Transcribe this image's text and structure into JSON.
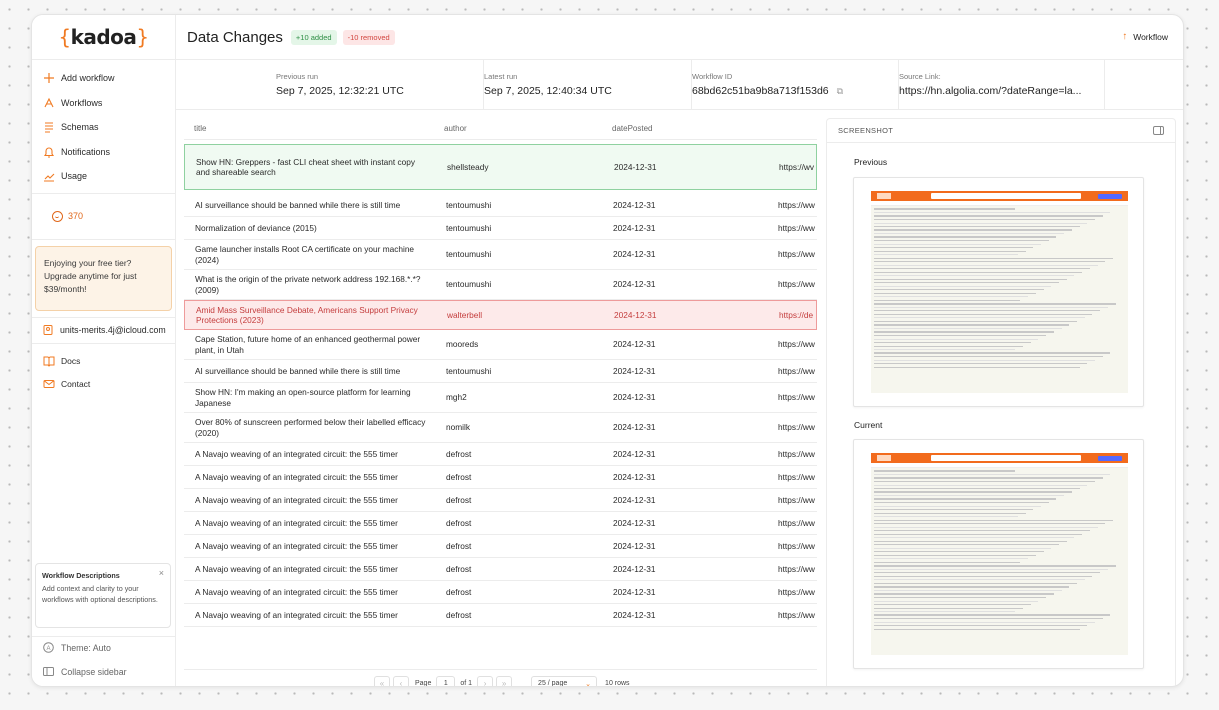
{
  "brand": {
    "logo_open": "{",
    "logo_text": "kadoa",
    "logo_close": "}"
  },
  "sidebar": {
    "nav": [
      {
        "label": "Add workflow",
        "icon": "plus-icon"
      },
      {
        "label": "Workflows",
        "icon": "workflow-icon"
      },
      {
        "label": "Schemas",
        "icon": "schema-icon"
      },
      {
        "label": "Notifications",
        "icon": "bell-icon"
      },
      {
        "label": "Usage",
        "icon": "chart-icon"
      }
    ],
    "credits": "370",
    "upsell": "Enjoying your free tier? Upgrade anytime for just $39/month!",
    "user_email": "units-merits.4j@icloud.com",
    "links": [
      {
        "label": "Docs",
        "icon": "book-icon"
      },
      {
        "label": "Contact",
        "icon": "mail-icon"
      }
    ],
    "workflow_desc": {
      "title": "Workflow Descriptions",
      "close": "×",
      "body": "Add context and clarity to your workflows with optional descriptions."
    },
    "theme": "Theme: Auto",
    "collapse": "Collapse sidebar"
  },
  "header": {
    "title": "Data Changes",
    "added_badge": "+10 added",
    "removed_badge": "-10 removed",
    "workflow_button": "Workflow"
  },
  "run_info": {
    "previous_label": "Previous run",
    "previous_value": "Sep 7, 2025, 12:32:21 UTC",
    "latest_label": "Latest run",
    "latest_value": "Sep 7, 2025, 12:40:34 UTC",
    "workflow_id_label": "Workflow ID",
    "workflow_id_value": "68bd62c51ba9b8a713f153d6",
    "source_label": "Source Link:",
    "source_value": "https://hn.algolia.com/?dateRange=la..."
  },
  "table": {
    "columns": [
      "title",
      "author",
      "datePosted"
    ],
    "rows": [
      {
        "title": "Show HN: Greppers - fast CLI cheat sheet with instant copy and shareable search",
        "author": "shellsteady",
        "date": "2024-12-31",
        "url": "https://wv",
        "status": "added"
      },
      {
        "title": "AI surveillance should be banned while there is still time",
        "author": "tentoumushi",
        "date": "2024-12-31",
        "url": "https://ww",
        "status": ""
      },
      {
        "title": "Normalization of deviance (2015)",
        "author": "tentoumushi",
        "date": "2024-12-31",
        "url": "https://ww",
        "status": ""
      },
      {
        "title": "Game launcher installs Root CA certificate on your machine (2024)",
        "author": "tentoumushi",
        "date": "2024-12-31",
        "url": "https://ww",
        "status": ""
      },
      {
        "title": "What is the origin of the private network address 192.168.*.*? (2009)",
        "author": "tentoumushi",
        "date": "2024-12-31",
        "url": "https://ww",
        "status": ""
      },
      {
        "title": "Amid Mass Surveillance Debate, Americans Support Privacy Protections (2023)",
        "author": "walterbell",
        "date": "2024-12-31",
        "url": "https://de",
        "status": "removed"
      },
      {
        "title": "Cape Station, future home of an enhanced geothermal power plant, in Utah",
        "author": "mooreds",
        "date": "2024-12-31",
        "url": "https://ww",
        "status": ""
      },
      {
        "title": "AI surveillance should be banned while there is still time",
        "author": "tentoumushi",
        "date": "2024-12-31",
        "url": "https://ww",
        "status": ""
      },
      {
        "title": "Show HN: I'm making an open-source platform for learning Japanese",
        "author": "mgh2",
        "date": "2024-12-31",
        "url": "https://ww",
        "status": ""
      },
      {
        "title": "Over 80% of sunscreen performed below their labelled efficacy (2020)",
        "author": "nomilk",
        "date": "2024-12-31",
        "url": "https://ww",
        "status": ""
      },
      {
        "title": "A Navajo weaving of an integrated circuit: the 555 timer",
        "author": "defrost",
        "date": "2024-12-31",
        "url": "https://ww",
        "status": ""
      },
      {
        "title": "A Navajo weaving of an integrated circuit: the 555 timer",
        "author": "defrost",
        "date": "2024-12-31",
        "url": "https://ww",
        "status": ""
      },
      {
        "title": "A Navajo weaving of an integrated circuit: the 555 timer",
        "author": "defrost",
        "date": "2024-12-31",
        "url": "https://ww",
        "status": ""
      },
      {
        "title": "A Navajo weaving of an integrated circuit: the 555 timer",
        "author": "defrost",
        "date": "2024-12-31",
        "url": "https://ww",
        "status": ""
      },
      {
        "title": "A Navajo weaving of an integrated circuit: the 555 timer",
        "author": "defrost",
        "date": "2024-12-31",
        "url": "https://ww",
        "status": ""
      },
      {
        "title": "A Navajo weaving of an integrated circuit: the 555 timer",
        "author": "defrost",
        "date": "2024-12-31",
        "url": "https://ww",
        "status": ""
      },
      {
        "title": "A Navajo weaving of an integrated circuit: the 555 timer",
        "author": "defrost",
        "date": "2024-12-31",
        "url": "https://ww",
        "status": ""
      },
      {
        "title": "A Navajo weaving of an integrated circuit: the 555 timer",
        "author": "defrost",
        "date": "2024-12-31",
        "url": "https://ww",
        "status": ""
      }
    ]
  },
  "pagination": {
    "page_label": "Page",
    "page_value": "1",
    "of_label": "of 1",
    "per_page": "25 / page",
    "rows_count": "10 rows"
  },
  "screenshot": {
    "header": "SCREENSHOT",
    "previous_label": "Previous",
    "current_label": "Current"
  },
  "colors": {
    "accent": "#f07a22",
    "added_bg": "#f0faf2",
    "removed_bg": "#fdeaea"
  }
}
